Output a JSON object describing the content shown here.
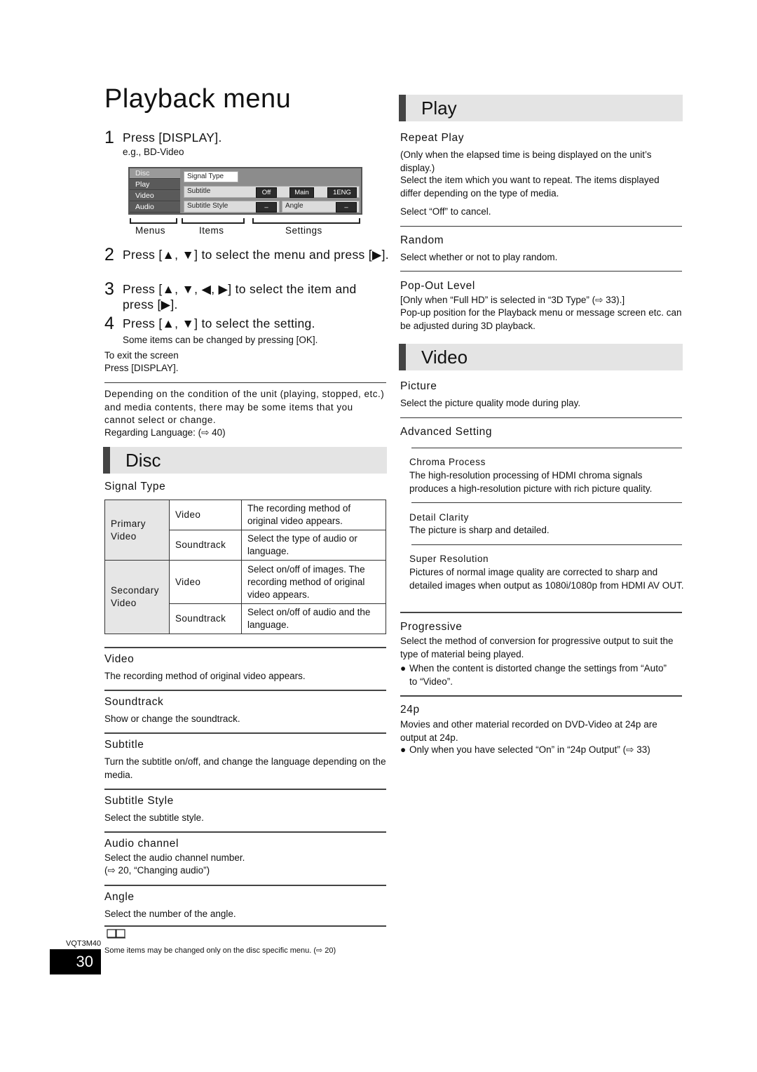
{
  "page": {
    "title": "Playback menu",
    "page_number": "30",
    "model_code": "VQT3M40"
  },
  "steps": [
    {
      "num": "1",
      "text": "Press [DISPLAY]."
    },
    {
      "num": "2",
      "text": "Press [▲, ▼] to select the menu and press [▶]."
    },
    {
      "num": "3",
      "text": "Press [▲, ▼, ◀, ▶] to select the item and press [▶]."
    },
    {
      "num": "4",
      "text": "Press [▲, ▼] to select the setting."
    }
  ],
  "example_label": "e.g., BD-Video",
  "step4_note": "Some items can be changed by pressing [OK].",
  "exit": {
    "line1": "To exit the screen",
    "line2": "Press [DISPLAY]."
  },
  "osd": {
    "menus": [
      "Disc",
      "Play",
      "Video",
      "Audio"
    ],
    "selected_menu": "Disc",
    "items": {
      "signal_type": "Signal Type",
      "subtitle": "Subtitle",
      "subtitle_values": [
        "Off",
        "Main",
        "1ENG"
      ],
      "subtitle_style": "Subtitle Style",
      "subtitle_style_value": "–",
      "angle": "Angle",
      "angle_value": "–"
    },
    "labels": {
      "menus": "Menus",
      "items": "Items",
      "settings": "Settings"
    }
  },
  "notice": "Depending on the condition of the unit (playing, stopped, etc.) and media contents, there may be some items that you cannot select or change.",
  "language_ref": "Regarding Language: (⇨ 40)",
  "disc": {
    "heading": "Disc",
    "signal_type": {
      "title": "Signal Type",
      "rows": [
        {
          "group": "Primary Video",
          "item": "Video",
          "desc": "The recording method of original video appears."
        },
        {
          "group": "Primary Video",
          "item": "Soundtrack",
          "desc": "Select the type of audio or language."
        },
        {
          "group": "Secondary Video",
          "item": "Video",
          "desc": "Select on/off of images. The recording method of original video appears."
        },
        {
          "group": "Secondary Video",
          "item": "Soundtrack",
          "desc": "Select on/off of audio and the language."
        }
      ]
    },
    "items": [
      {
        "title": "Video",
        "desc": "The recording method of original video appears."
      },
      {
        "title": "Soundtrack",
        "desc": "Show or change the soundtrack."
      },
      {
        "title": "Subtitle",
        "desc": "Turn the subtitle on/off, and change the language depending on the media."
      },
      {
        "title": "Subtitle Style",
        "desc": "Select the subtitle style."
      },
      {
        "title": "Audio channel",
        "desc": "Select the audio channel number.",
        "desc2": "(⇨ 20, “Changing audio”)"
      },
      {
        "title": "Angle",
        "desc": "Select the number of the angle."
      }
    ],
    "footnote_icon": "book-icon",
    "footnote": "Some items may be changed only on the disc specific menu. (⇨ 20)"
  },
  "play": {
    "heading": "Play",
    "items": [
      {
        "title": "Repeat Play",
        "desc": "(Only when the elapsed time is being displayed on the unit’s display.)",
        "desc2": "Select the item which you want to repeat. The items displayed differ depending on the type of media.",
        "desc3": "Select “Off” to cancel."
      },
      {
        "title": "Random",
        "desc": "Select whether or not to play random."
      },
      {
        "title": "Pop-Out Level",
        "desc": "[Only when “Full HD” is selected in “3D Type” (⇨ 33).]",
        "desc2": "Pop-up position for the Playback menu or message screen etc. can be adjusted during 3D playback."
      }
    ]
  },
  "video": {
    "heading": "Video",
    "picture": {
      "title": "Picture",
      "desc": "Select the picture quality mode during play."
    },
    "advanced": {
      "title": "Advanced Setting",
      "subitems": [
        {
          "title": "Chroma Process",
          "desc": "The high-resolution processing of HDMI chroma signals produces a high-resolution picture with rich picture quality."
        },
        {
          "title": "Detail Clarity",
          "desc": "The picture is sharp and detailed."
        },
        {
          "title": "Super Resolution",
          "desc": "Pictures of normal image quality are corrected to sharp and detailed images when output as 1080i/1080p from HDMI AV OUT."
        }
      ]
    },
    "progressive": {
      "title": "Progressive",
      "desc": "Select the method of conversion for progressive output to suit the type of material being played.",
      "bullet": "When the content is distorted change the settings from “Auto” to “Video”."
    },
    "p24": {
      "title": "24p",
      "desc": "Movies and other material recorded on DVD-Video at 24p are output at 24p.",
      "bullet": "Only when you have selected “On” in “24p Output” (⇨ 33)"
    }
  }
}
